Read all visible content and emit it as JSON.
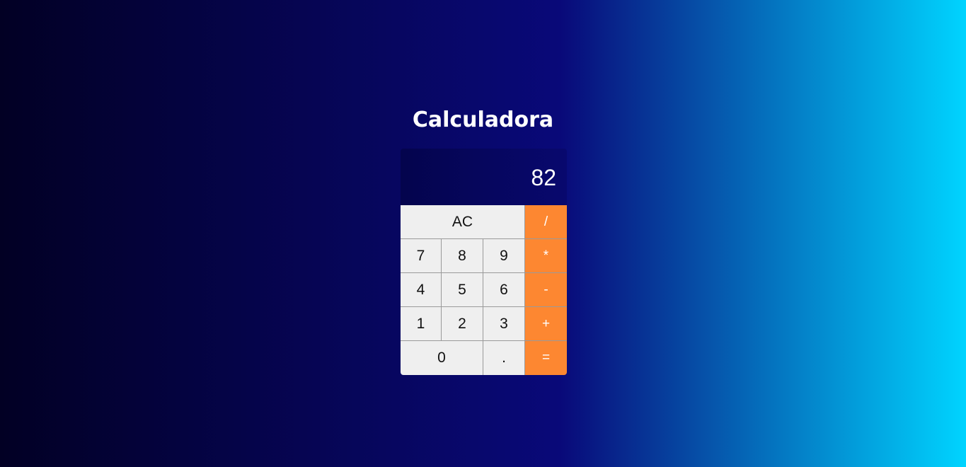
{
  "app": {
    "title": "Calculadora"
  },
  "display": {
    "value": "82"
  },
  "keys": {
    "clear": "AC",
    "divide": "/",
    "multiply": "*",
    "subtract": "-",
    "add": "+",
    "equals": "=",
    "seven": "7",
    "eight": "8",
    "nine": "9",
    "four": "4",
    "five": "5",
    "six": "6",
    "one": "1",
    "two": "2",
    "three": "3",
    "zero": "0",
    "decimal": "."
  },
  "colors": {
    "operator_key": "#fd8731",
    "number_key": "#efefef",
    "display_bg": "#06065c",
    "gradient_start": "#020024",
    "gradient_mid": "#090979",
    "gradient_end": "#00d4ff"
  }
}
